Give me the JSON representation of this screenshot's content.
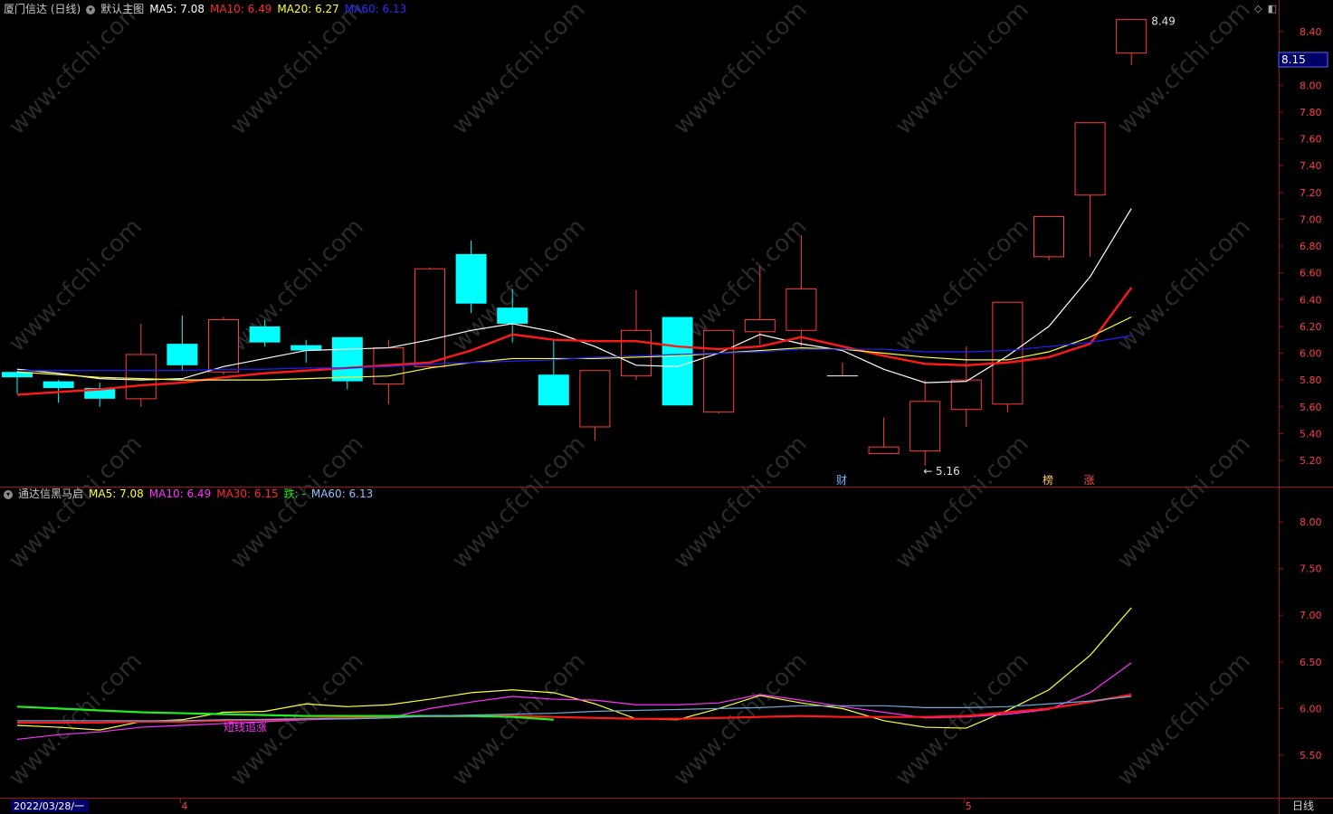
{
  "main_header": {
    "stock_name": "厦门信达 (日线)",
    "chart_name": "默认主图",
    "ma5": "MA5: 7.08",
    "ma10": "MA10: 6.49",
    "ma20": "MA20: 6.27",
    "ma60": "MA60: 6.13"
  },
  "sub_header": {
    "indicator_name": "通达信黑马启",
    "ma5": "MA5: 7.08",
    "ma10": "MA10: 6.49",
    "ma30": "MA30: 6.15",
    "die": "跌: -",
    "ma60": "MA60: 6.13"
  },
  "price_badge": "8.15",
  "colors": {
    "up": "#ff3c3c",
    "down": "#00ffff",
    "ma5": "#ffffff",
    "ma10": "#ff1a1a",
    "ma20": "#ffff33",
    "ma60": "#2020ff",
    "axis": "#a01010",
    "sub_ma5": "#ffff33",
    "sub_ma10": "#ff33ff",
    "sub_ma30": "#ff1a1a",
    "sub_green": "#22ee22",
    "sub_ma60": "#6fa8dc"
  },
  "chart_data": [
    {
      "type": "candlestick",
      "title": "厦门信达 (日线)",
      "ylim": [
        5.1,
        8.6
      ],
      "y_ticks": [
        "8.40",
        "8.20",
        "8.00",
        "7.80",
        "7.60",
        "7.40",
        "7.20",
        "7.00",
        "6.80",
        "6.60",
        "6.40",
        "6.20",
        "6.00",
        "5.80",
        "5.60",
        "5.40",
        "5.20"
      ],
      "candles": [
        {
          "o": 5.86,
          "h": 5.87,
          "l": 5.7,
          "c": 5.82
        },
        {
          "o": 5.79,
          "h": 5.8,
          "l": 5.63,
          "c": 5.74
        },
        {
          "o": 5.74,
          "h": 5.78,
          "l": 5.6,
          "c": 5.66
        },
        {
          "o": 5.66,
          "h": 6.22,
          "l": 5.6,
          "c": 5.99
        },
        {
          "o": 6.07,
          "h": 6.28,
          "l": 5.87,
          "c": 5.91
        },
        {
          "o": 5.86,
          "h": 6.27,
          "l": 5.84,
          "c": 6.25
        },
        {
          "o": 6.2,
          "h": 6.25,
          "l": 6.05,
          "c": 6.08
        },
        {
          "o": 6.06,
          "h": 6.1,
          "l": 5.93,
          "c": 6.02
        },
        {
          "o": 6.12,
          "h": 6.12,
          "l": 5.73,
          "c": 5.79
        },
        {
          "o": 5.77,
          "h": 6.1,
          "l": 5.62,
          "c": 6.04
        },
        {
          "o": 5.9,
          "h": 6.64,
          "l": 5.88,
          "c": 6.63
        },
        {
          "o": 6.74,
          "h": 6.84,
          "l": 6.3,
          "c": 6.37
        },
        {
          "o": 6.34,
          "h": 6.48,
          "l": 6.08,
          "c": 6.22
        },
        {
          "o": 5.84,
          "h": 6.1,
          "l": 5.61,
          "c": 5.61
        },
        {
          "o": 5.45,
          "h": 5.87,
          "l": 5.35,
          "c": 5.87
        },
        {
          "o": 5.83,
          "h": 6.47,
          "l": 5.8,
          "c": 6.17
        },
        {
          "o": 6.27,
          "h": 6.27,
          "l": 5.61,
          "c": 5.61
        },
        {
          "o": 5.56,
          "h": 6.17,
          "l": 5.55,
          "c": 6.17
        },
        {
          "o": 6.16,
          "h": 6.65,
          "l": 6.06,
          "c": 6.25
        },
        {
          "o": 6.17,
          "h": 6.88,
          "l": 6.05,
          "c": 6.48
        },
        {
          "o": 5.83,
          "h": 5.93,
          "l": 5.83,
          "c": 5.83
        },
        {
          "o": 5.25,
          "h": 5.52,
          "l": 5.25,
          "c": 5.3
        },
        {
          "o": 5.27,
          "h": 5.8,
          "l": 5.16,
          "c": 5.64
        },
        {
          "o": 5.58,
          "h": 6.05,
          "l": 5.45,
          "c": 5.8
        },
        {
          "o": 5.62,
          "h": 6.38,
          "l": 5.56,
          "c": 6.38
        },
        {
          "o": 6.72,
          "h": 7.02,
          "l": 6.69,
          "c": 7.02
        },
        {
          "o": 7.18,
          "h": 7.72,
          "l": 6.72,
          "c": 7.72
        },
        {
          "o": 8.24,
          "h": 8.49,
          "l": 8.15,
          "c": 8.49
        }
      ],
      "series": [
        {
          "name": "MA5",
          "values": [
            5.88,
            5.85,
            5.81,
            5.8,
            5.81,
            5.9,
            5.96,
            6.02,
            6.03,
            6.04,
            6.1,
            6.17,
            6.22,
            6.16,
            6.05,
            5.91,
            5.9,
            6.0,
            6.14,
            6.07,
            6.02,
            5.88,
            5.78,
            5.79,
            5.98,
            6.2,
            6.57,
            7.08
          ]
        },
        {
          "name": "MA10",
          "values": [
            5.69,
            5.71,
            5.73,
            5.76,
            5.78,
            5.82,
            5.85,
            5.87,
            5.89,
            5.91,
            5.93,
            6.02,
            6.14,
            6.1,
            6.09,
            6.09,
            6.05,
            6.03,
            6.05,
            6.12,
            6.05,
            5.98,
            5.92,
            5.91,
            5.93,
            5.97,
            6.07,
            6.49
          ]
        },
        {
          "name": "MA20",
          "values": [
            5.86,
            5.84,
            5.82,
            5.81,
            5.8,
            5.8,
            5.8,
            5.81,
            5.82,
            5.83,
            5.89,
            5.93,
            5.96,
            5.96,
            5.96,
            5.97,
            5.98,
            6.0,
            6.02,
            6.04,
            6.03,
            6.0,
            5.97,
            5.95,
            5.95,
            6.01,
            6.12,
            6.27
          ]
        },
        {
          "name": "MA60",
          "values": [
            5.87,
            5.87,
            5.87,
            5.87,
            5.87,
            5.88,
            5.88,
            5.89,
            5.89,
            5.9,
            5.92,
            5.93,
            5.94,
            5.95,
            5.97,
            5.98,
            5.99,
            6.0,
            6.01,
            6.03,
            6.03,
            6.03,
            6.01,
            6.01,
            6.02,
            6.05,
            6.08,
            6.13
          ]
        }
      ],
      "annotations": [
        {
          "text": "8.49",
          "x": 27,
          "y": 8.49
        },
        {
          "text": "← 5.16",
          "x": 22,
          "y": 5.16
        }
      ],
      "markers": [
        {
          "text": "财",
          "x": 20,
          "color": "#6fb8ff"
        },
        {
          "text": "榜",
          "x": 25,
          "color": "#ffc864"
        },
        {
          "text": "涨",
          "x": 26,
          "color": "#ff5050"
        }
      ]
    },
    {
      "type": "line",
      "title": "通达信黑马启",
      "ylim": [
        5.35,
        8.3
      ],
      "y_ticks": [
        "8.00",
        "7.50",
        "7.00",
        "6.50",
        "6.00",
        "5.50"
      ],
      "series": [
        {
          "name": "MA5",
          "values": [
            5.82,
            5.8,
            5.77,
            5.86,
            5.88,
            5.96,
            5.97,
            6.05,
            6.02,
            6.04,
            6.1,
            6.17,
            6.2,
            6.17,
            6.05,
            5.89,
            5.88,
            6.0,
            6.14,
            6.06,
            6.0,
            5.87,
            5.8,
            5.79,
            5.98,
            6.2,
            6.57,
            7.08
          ]
        },
        {
          "name": "MA10",
          "values": [
            5.67,
            5.72,
            5.75,
            5.8,
            5.82,
            5.84,
            5.86,
            5.88,
            5.89,
            5.9,
            6.0,
            6.07,
            6.13,
            6.1,
            6.09,
            6.04,
            6.04,
            6.06,
            6.15,
            6.09,
            6.02,
            5.96,
            5.9,
            5.91,
            5.94,
            5.99,
            6.17,
            6.49
          ]
        },
        {
          "name": "MA30",
          "values": [
            5.85,
            5.85,
            5.85,
            5.86,
            5.86,
            5.87,
            5.88,
            5.89,
            5.9,
            5.91,
            5.92,
            5.92,
            5.92,
            5.91,
            5.9,
            5.89,
            5.89,
            5.9,
            5.91,
            5.92,
            5.91,
            5.91,
            5.91,
            5.92,
            5.96,
            6.0,
            6.07,
            6.15
          ]
        },
        {
          "name": "跌",
          "values": [
            6.02,
            6.0,
            5.98,
            5.96,
            5.95,
            5.94,
            5.93,
            5.92,
            5.92,
            5.92,
            5.92,
            5.92,
            5.91,
            5.88
          ]
        },
        {
          "name": "MA60",
          "values": [
            5.87,
            5.87,
            5.87,
            5.87,
            5.87,
            5.88,
            5.88,
            5.89,
            5.89,
            5.9,
            5.92,
            5.93,
            5.94,
            5.95,
            5.97,
            5.98,
            5.99,
            6.0,
            6.01,
            6.03,
            6.03,
            6.03,
            6.01,
            6.01,
            6.02,
            6.05,
            6.08,
            6.13
          ]
        }
      ],
      "annotations": [
        {
          "text": "短线追涨",
          "x": 5,
          "y": 5.82
        }
      ]
    }
  ],
  "x_axis": {
    "date_label": "2022/03/28/一",
    "month_labels": [
      {
        "text": "4",
        "x": 4
      },
      {
        "text": "5",
        "x": 23
      }
    ],
    "period_button": "日线"
  },
  "watermark": "www.cfchi.com",
  "top_icons": [
    "diamond-icon",
    "restore-icon"
  ]
}
